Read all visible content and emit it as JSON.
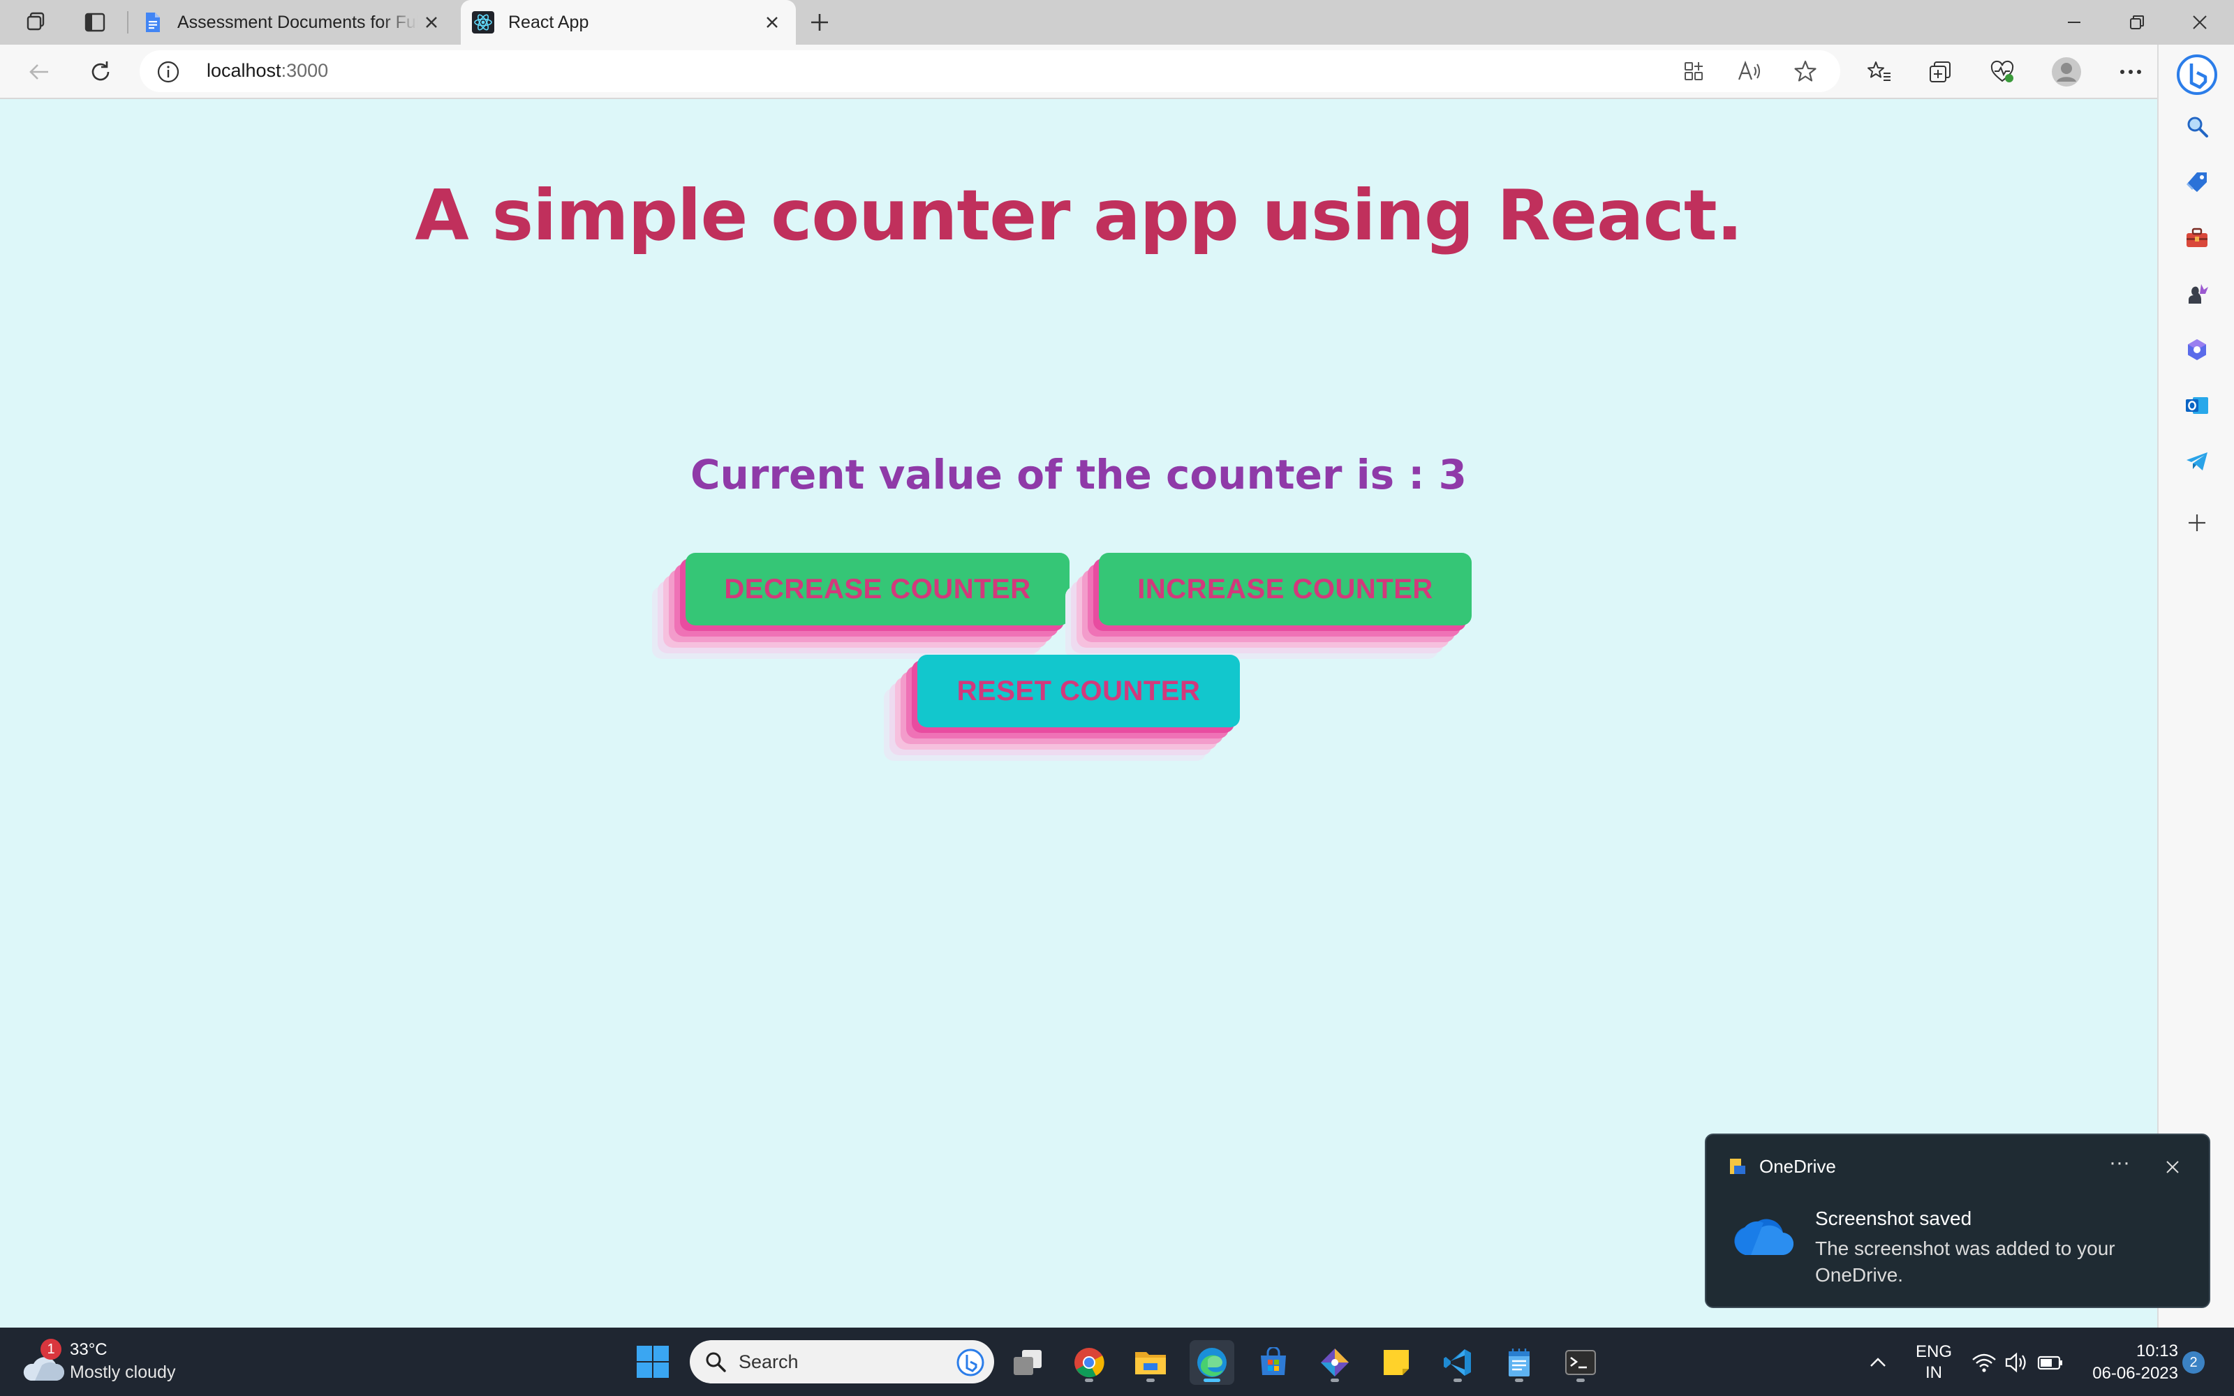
{
  "browser": {
    "tabs": [
      {
        "title": "Assessment Documents for Full S",
        "active": false
      },
      {
        "title": "React App",
        "active": true
      }
    ],
    "url_host": "localhost",
    "url_port": ":3000"
  },
  "page": {
    "heading": "A simple counter app using React.",
    "counter_text": "Current value of the counter is : 3",
    "buttons": {
      "decrease": "DECREASE COUNTER",
      "increase": "INCREASE COUNTER",
      "reset": "RESET COUNTER"
    }
  },
  "sidebar_icons": [
    "search-icon",
    "shopping-tag-icon",
    "toolbox-icon",
    "games-icon",
    "copilot-icon",
    "outlook-icon",
    "telegram-icon",
    "add-icon"
  ],
  "toast": {
    "app": "OneDrive",
    "title": "Screenshot saved",
    "body": "The screenshot was added to your OneDrive.",
    "more": "···"
  },
  "taskbar": {
    "weather_temp": "33°C",
    "weather_desc": "Mostly cloudy",
    "weather_badge": "1",
    "search_placeholder": "Search",
    "lang_line1": "ENG",
    "lang_line2": "IN",
    "time": "10:13",
    "date": "06-06-2023",
    "notification_count": "2"
  },
  "colors": {
    "page_bg": "#ddf7f9",
    "heading": "#c0305c",
    "counter_text": "#8f3aa8",
    "button_green": "#35c676",
    "button_cyan": "#12c7cd",
    "button_text": "#d2397c"
  }
}
